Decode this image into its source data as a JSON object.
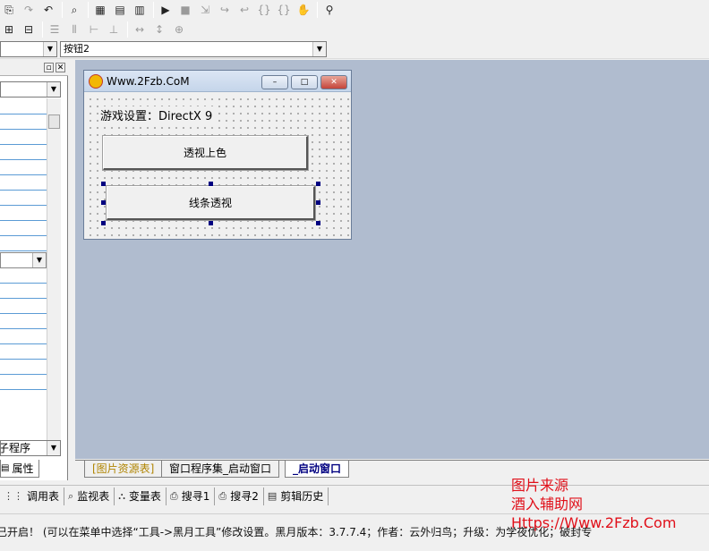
{
  "toolbar": {
    "row1_icons": [
      "paste-icon",
      "redo-icon",
      "undo-icon",
      "find-icon",
      "window-layout-icon",
      "window-layout2-icon",
      "window-layout3-icon",
      "run-icon",
      "stop-icon",
      "step-into-icon",
      "step-over-icon",
      "step-out-icon",
      "step-brace-icon",
      "step-brace2-icon",
      "hand-icon",
      "watch-icon"
    ],
    "row2_icons": [
      "align-center-icon",
      "align-middle-icon",
      "spacing-h-icon",
      "spacing-v-icon",
      "center-h-icon",
      "center-v-icon",
      "same-width-icon",
      "same-height-icon",
      "same-size-icon"
    ]
  },
  "property_bar": {
    "left_combo_value": "",
    "control_combo_value": "按钮2"
  },
  "left_panel": {
    "bottom_combo_value": "子程序",
    "tab_label": "属性"
  },
  "form": {
    "title": "Www.2Fzb.CoM",
    "minimize_glyph": "–",
    "maximize_glyph": "□",
    "close_glyph": "✕",
    "label_text": "游戏设置：DirectX 9",
    "button1_label": "透视上色",
    "button2_label": "线条透视"
  },
  "document_tabs": {
    "tab1": "[图片资源表]",
    "tab2": "窗口程序集_启动窗口",
    "tab3": "_启动窗口"
  },
  "output_tabs": {
    "calls": "调用表",
    "monitor": "监视表",
    "variables": "变量表",
    "search1": "搜寻1",
    "search2": "搜寻2",
    "clipboard": "剪辑历史"
  },
  "status": {
    "text": "已开启！   (可以在菜单中选择“工具->黑月工具”修改设置。黑月版本：3.7.7.4；作者：云外归鸟；升级：为学夜优化；破封专"
  },
  "watermark": {
    "line1": "图片来源",
    "line2": "酒入辅助网",
    "line3": "Https://Www.2Fzb.Com"
  },
  "colors": {
    "designer_bg": "#b0bccf",
    "selection_handle": "#000080",
    "watermark": "#e0101a"
  }
}
